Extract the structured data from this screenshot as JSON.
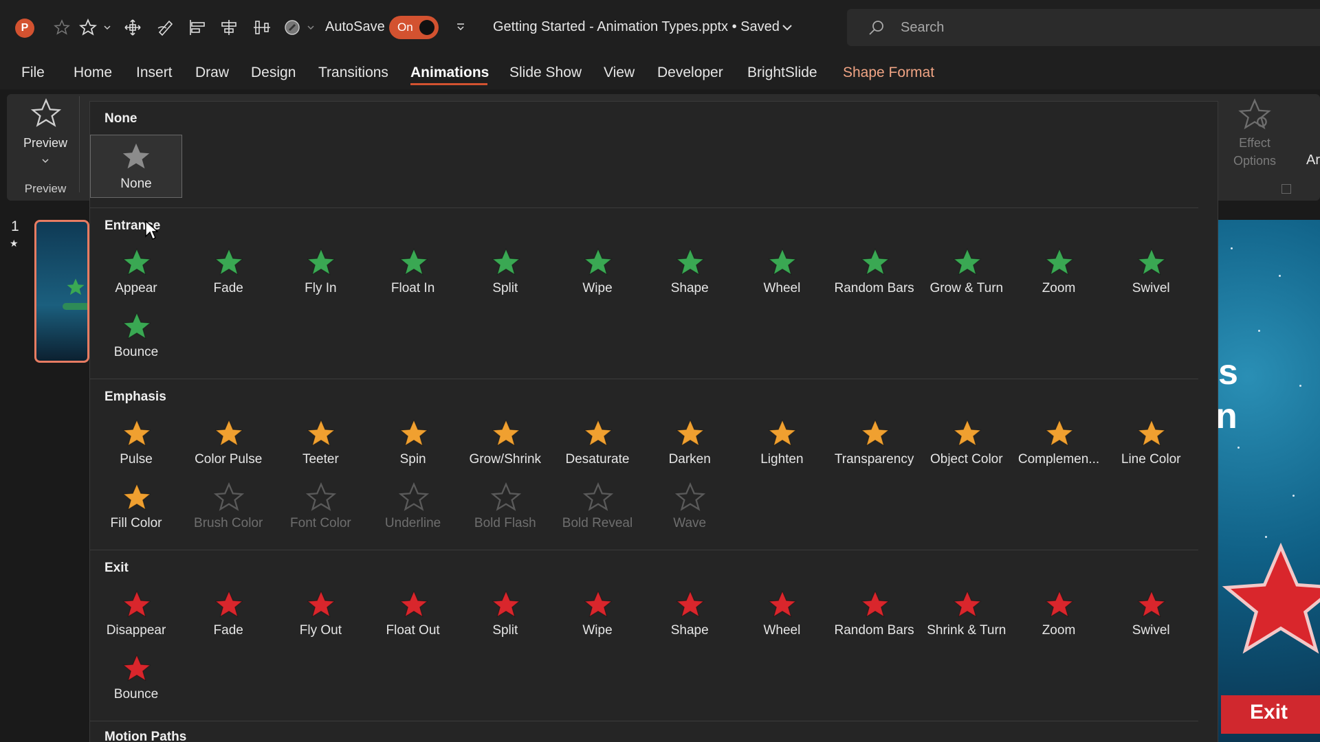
{
  "titlebar": {
    "app_logo": "P",
    "autosave_label": "AutoSave",
    "autosave_state": "On",
    "doc_title": "Getting Started - Animation Types.pptx • Saved",
    "search_placeholder": "Search"
  },
  "menu": {
    "tabs": [
      "File",
      "Home",
      "Insert",
      "Draw",
      "Design",
      "Transitions",
      "Animations",
      "Slide Show",
      "View",
      "Developer",
      "BrightSlide",
      "Shape Format"
    ],
    "active_tab": "Animations"
  },
  "ribbon": {
    "preview_label": "Preview",
    "preview_group_label": "Preview",
    "effect_options_line1": "Effect",
    "effect_options_line2": "Options",
    "cut_text": "Ar"
  },
  "slides": {
    "number": "1",
    "canvas_text_1": "s",
    "canvas_text_2": "n",
    "exit_banner": "Exit"
  },
  "gallery": {
    "none_section": {
      "title": "None",
      "item": "None"
    },
    "entrance": {
      "title": "Entrance",
      "items": [
        "Appear",
        "Fade",
        "Fly In",
        "Float In",
        "Split",
        "Wipe",
        "Shape",
        "Wheel",
        "Random Bars",
        "Grow & Turn",
        "Zoom",
        "Swivel",
        "Bounce"
      ]
    },
    "emphasis": {
      "title": "Emphasis",
      "items": [
        "Pulse",
        "Color Pulse",
        "Teeter",
        "Spin",
        "Grow/Shrink",
        "Desaturate",
        "Darken",
        "Lighten",
        "Transparency",
        "Object Color",
        "Complemen...",
        "Line Color",
        "Fill Color",
        "Brush Color",
        "Font Color",
        "Underline",
        "Bold Flash",
        "Bold Reveal",
        "Wave"
      ],
      "disabled": [
        "Brush Color",
        "Font Color",
        "Underline",
        "Bold Flash",
        "Bold Reveal",
        "Wave"
      ]
    },
    "exit": {
      "title": "Exit",
      "items": [
        "Disappear",
        "Fade",
        "Fly Out",
        "Float Out",
        "Split",
        "Wipe",
        "Shape",
        "Wheel",
        "Random Bars",
        "Shrink & Turn",
        "Zoom",
        "Swivel",
        "Bounce"
      ]
    },
    "motion_paths": {
      "title": "Motion Paths"
    }
  },
  "colors": {
    "accent": "#d35230",
    "entrance_star": "#3aa853",
    "emphasis_star": "#f0a030",
    "exit_star": "#d9262c",
    "disabled_star": "#5a5a5a",
    "none_star": "#9a9a9a"
  }
}
